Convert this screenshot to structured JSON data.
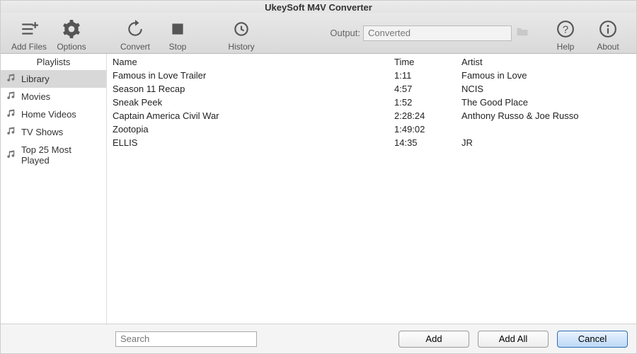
{
  "app_title": "UkeySoft M4V Converter",
  "toolbar": {
    "addfiles": "Add Files",
    "options": "Options",
    "convert": "Convert",
    "stop": "Stop",
    "history": "History",
    "help": "Help",
    "about": "About",
    "output_label": "Output:",
    "output_value": "Converted"
  },
  "sidebar": {
    "header": "Playlists",
    "items": [
      {
        "label": "Library",
        "selected": true
      },
      {
        "label": "Movies",
        "selected": false
      },
      {
        "label": "Home Videos",
        "selected": false
      },
      {
        "label": "TV Shows",
        "selected": false
      },
      {
        "label": "Top 25 Most Played",
        "selected": false
      }
    ]
  },
  "table": {
    "headers": {
      "name": "Name",
      "time": "Time",
      "artist": "Artist"
    },
    "rows": [
      {
        "name": "Famous in Love  Trailer",
        "time": "1:11",
        "artist": "Famous in Love"
      },
      {
        "name": "Season 11 Recap",
        "time": "4:57",
        "artist": "NCIS"
      },
      {
        "name": "Sneak Peek",
        "time": "1:52",
        "artist": "The Good Place"
      },
      {
        "name": "Captain America  Civil War",
        "time": "2:28:24",
        "artist": "Anthony Russo & Joe Russo"
      },
      {
        "name": "Zootopia",
        "time": "1:49:02",
        "artist": ""
      },
      {
        "name": "ELLIS",
        "time": "14:35",
        "artist": "JR"
      }
    ]
  },
  "footer": {
    "search_placeholder": "Search",
    "add": "Add",
    "addall": "Add All",
    "cancel": "Cancel"
  }
}
